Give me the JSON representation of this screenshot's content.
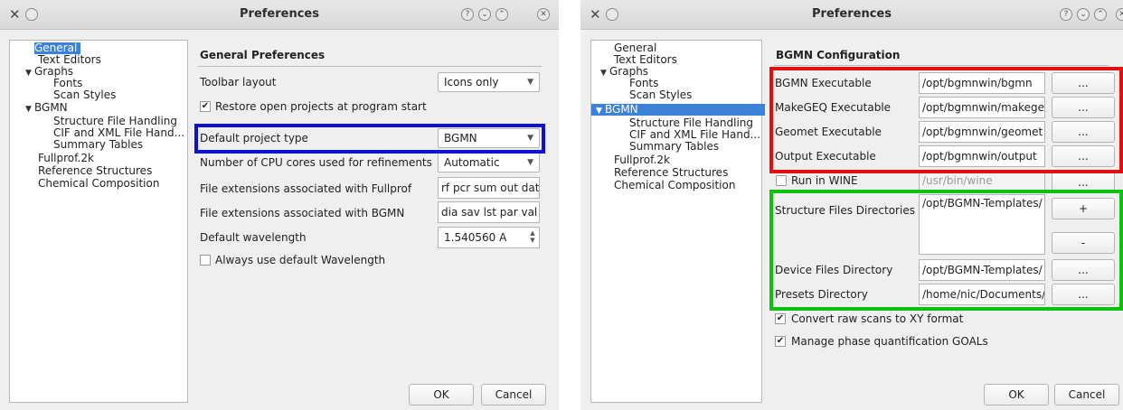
{
  "left_window": {
    "title": "Preferences",
    "titlebar_icons": [
      "app-icon",
      "help-icon",
      "minimize-icon",
      "maximize-icon",
      "close-icon"
    ],
    "titlebar_glyphs": {
      "app": "✕",
      "menu": "",
      "help": "?",
      "min": "⌄",
      "max": "⌃",
      "close": "✕"
    },
    "tree": [
      {
        "label": "General",
        "selected": true
      },
      {
        "label": "Text Editors"
      },
      {
        "label": "Graphs",
        "expanded": true
      },
      {
        "label": "Fonts"
      },
      {
        "label": "Scan Styles"
      },
      {
        "label": "BGMN",
        "expanded": true
      },
      {
        "label": "Structure File Handling"
      },
      {
        "label": "CIF and XML File Hand..."
      },
      {
        "label": "Summary Tables"
      },
      {
        "label": "Fullprof.2k"
      },
      {
        "label": "Reference Structures"
      },
      {
        "label": "Chemical Composition"
      }
    ],
    "heading": "General Preferences",
    "toolbar_layout": {
      "label": "Toolbar layout",
      "value": "Icons only"
    },
    "restore_projects": {
      "label": "Restore open projects at program start",
      "checked": true
    },
    "default_project": {
      "label": "Default project type",
      "value": "BGMN"
    },
    "cpu_cores": {
      "label": "Number of CPU cores used for refinements",
      "value": "Automatic"
    },
    "fullprof_ext": {
      "label": "File extensions associated with Fullprof",
      "value": "rf pcr sum out dat"
    },
    "bgmn_ext": {
      "label": "File extensions associated with BGMN",
      "value": "dia sav lst par val"
    },
    "wavelength": {
      "label": "Default wavelength",
      "value": "1.540560 A"
    },
    "always_default_wl": {
      "label": "Always use default Wavelength",
      "checked": false
    },
    "ok_label": "OK",
    "cancel_label": "Cancel",
    "highlight_color": "#1010d0"
  },
  "right_window": {
    "title": "Preferences",
    "tree": [
      {
        "label": "General"
      },
      {
        "label": "Text Editors"
      },
      {
        "label": "Graphs",
        "expanded": true
      },
      {
        "label": "Fonts"
      },
      {
        "label": "Scan Styles"
      },
      {
        "label": "BGMN",
        "expanded": true,
        "selected": true
      },
      {
        "label": "Structure File Handling"
      },
      {
        "label": "CIF and XML File Hand..."
      },
      {
        "label": "Summary Tables"
      },
      {
        "label": "Fullprof.2k"
      },
      {
        "label": "Reference Structures"
      },
      {
        "label": "Chemical Composition"
      }
    ],
    "heading": "BGMN Configuration",
    "executables": [
      {
        "label": "BGMN Executable",
        "value": "/opt/bgmnwin/bgmn",
        "button": "..."
      },
      {
        "label": "MakeGEQ Executable",
        "value": "/opt/bgmnwin/makege",
        "button": "..."
      },
      {
        "label": "Geomet Executable",
        "value": "/opt/bgmnwin/geomet",
        "button": "..."
      },
      {
        "label": "Output Executable",
        "value": "/opt/bgmnwin/output",
        "button": "..."
      }
    ],
    "run_in_wine": {
      "label": "Run in WINE",
      "checked": false,
      "value": "/usr/bin/wine",
      "button": "..."
    },
    "structure_dirs": {
      "label": "Structure Files Directories",
      "value": "/opt/BGMN-Templates/",
      "add_label": "+",
      "remove_label": "-"
    },
    "device_dir": {
      "label": "Device Files Directory",
      "value": "/opt/BGMN-Templates/",
      "button": "..."
    },
    "presets_dir": {
      "label": "Presets Directory",
      "value": "/home/nic/Documents/",
      "button": "..."
    },
    "convert_scans": {
      "label": "Convert raw scans to XY format",
      "checked": true
    },
    "manage_goals": {
      "label": "Manage phase quantification GOALs",
      "checked": true
    },
    "ok_label": "OK",
    "cancel_label": "Cancel",
    "highlight_red": "#e01010",
    "highlight_green": "#10c010"
  },
  "check_glyph": "✔",
  "caret_glyph": "▼",
  "tree_arrow_glyph": "▼",
  "spin_up": "▲",
  "spin_down": "▼"
}
